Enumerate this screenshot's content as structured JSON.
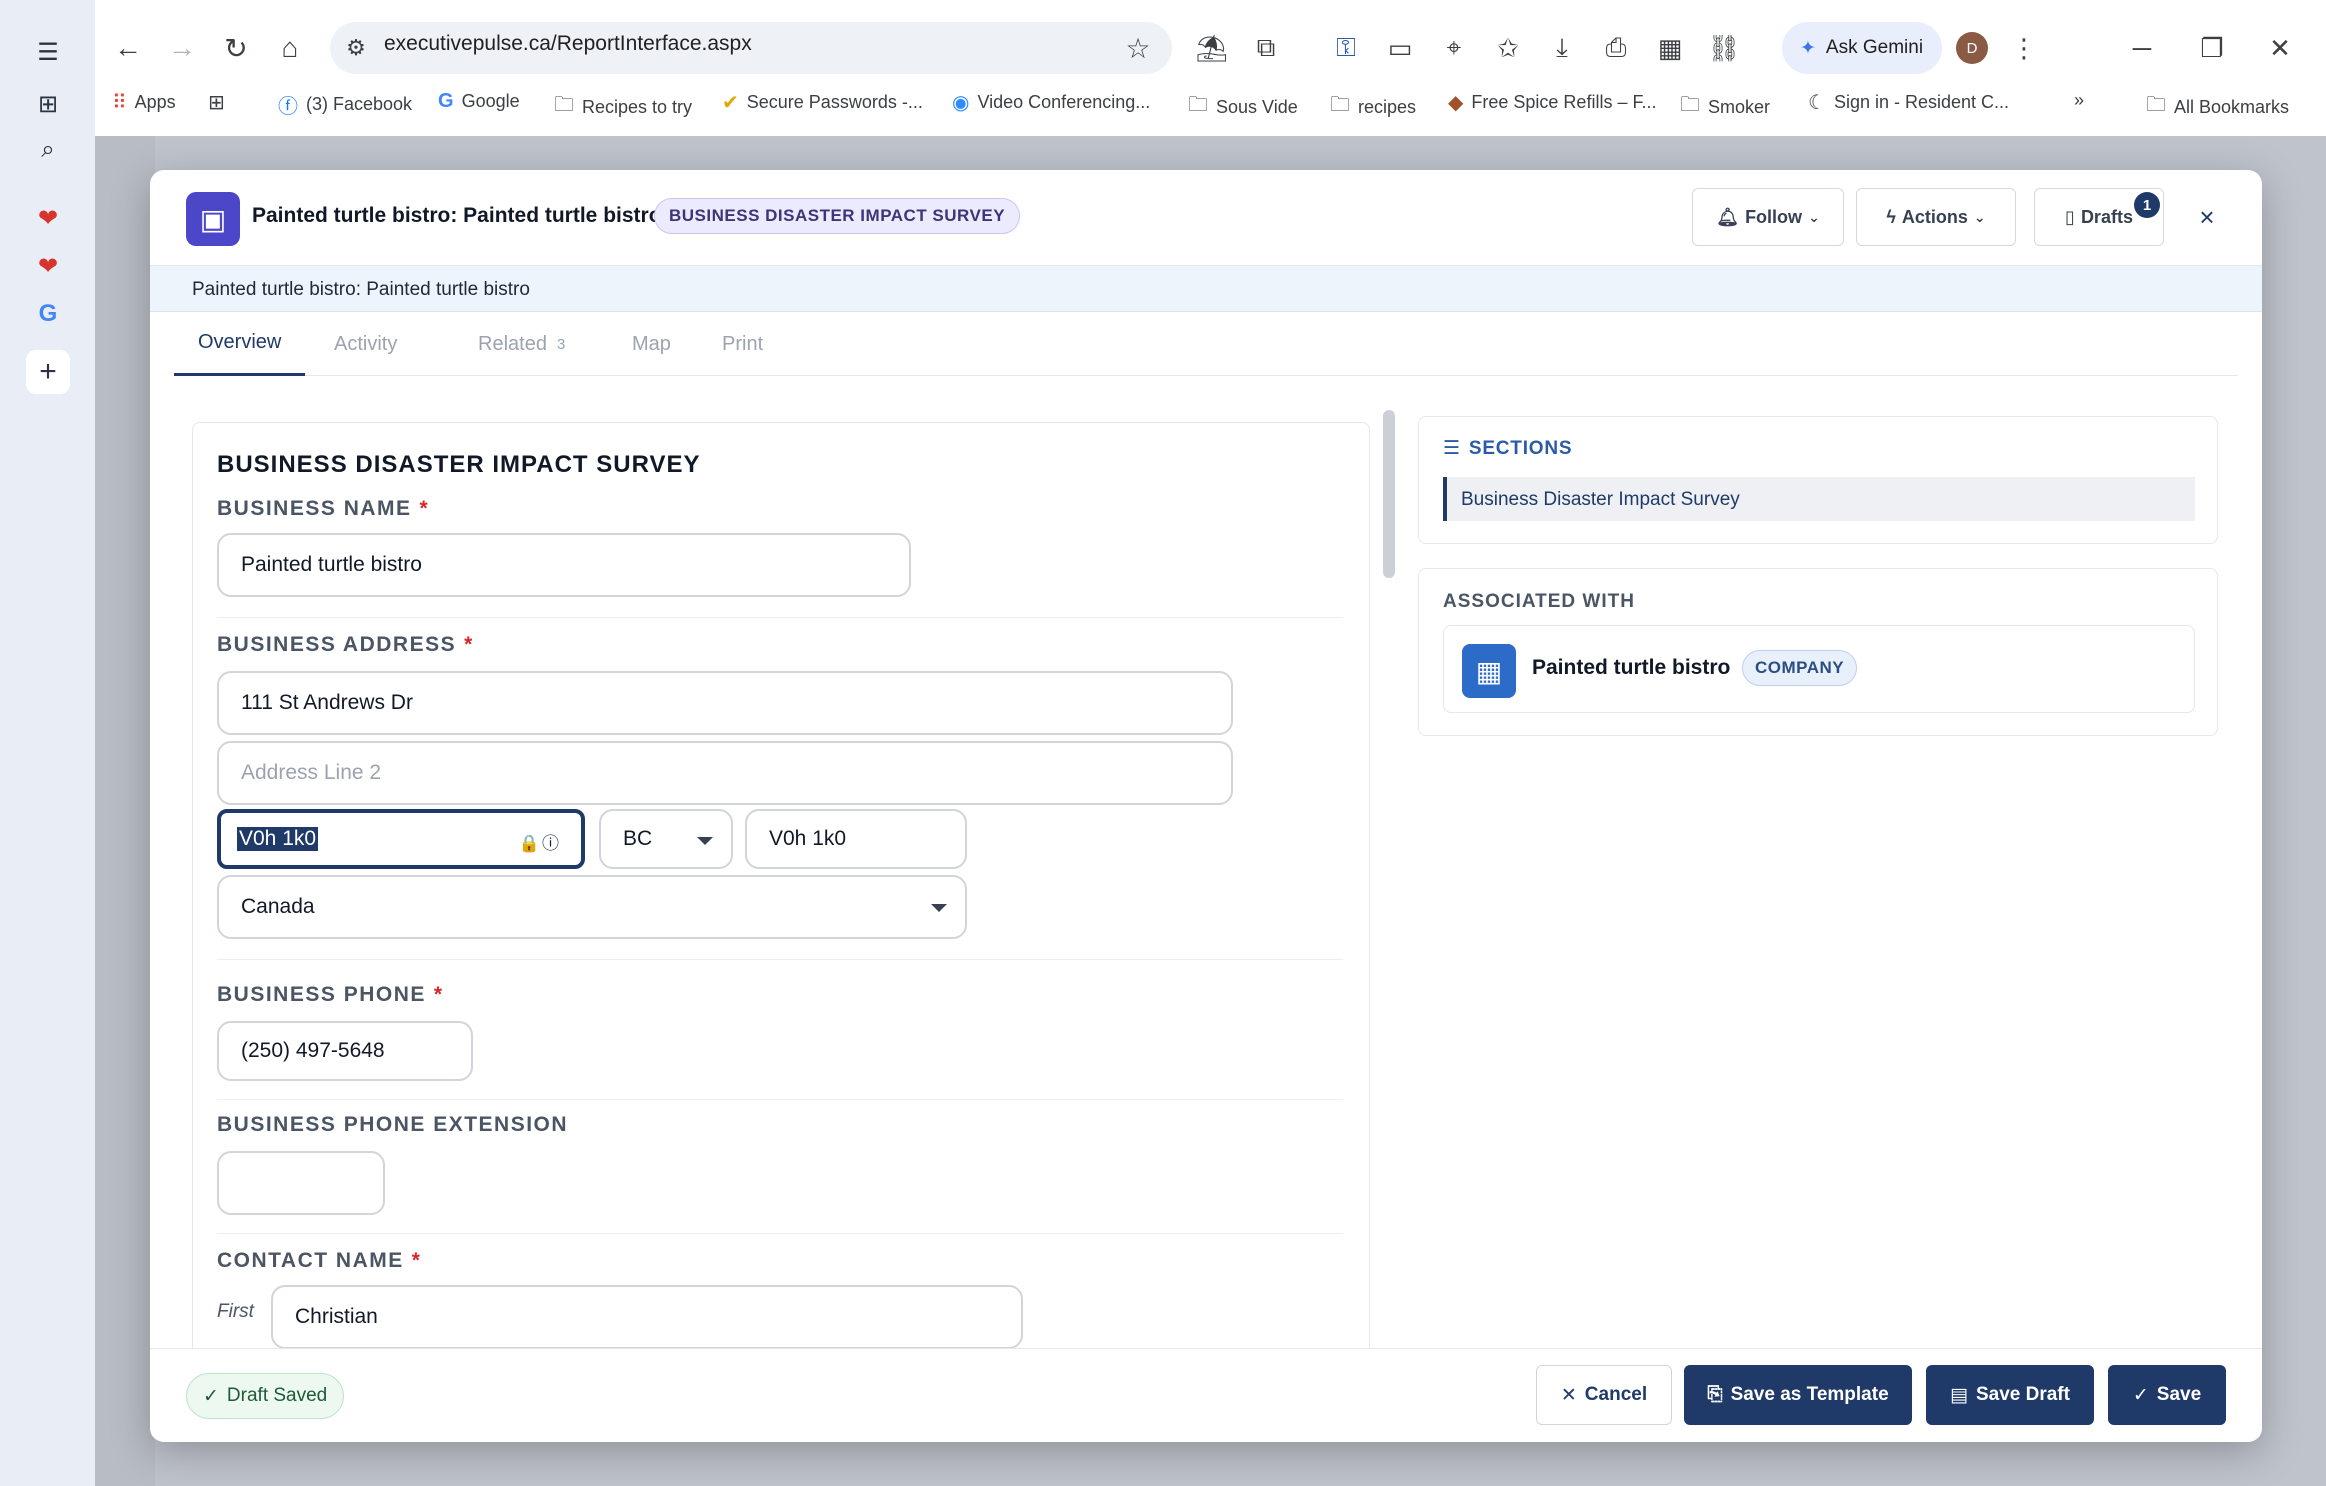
{
  "browser": {
    "url": "executivepulse.ca/ReportInterface.aspx",
    "ask_gemini": "Ask Gemini",
    "profile_initial": "D",
    "bookmarks": [
      {
        "label": "Apps",
        "icon": "apps-grid-icon"
      },
      {
        "label": "",
        "icon": "grid-icon"
      },
      {
        "label": "(3) Facebook",
        "icon": "facebook-icon"
      },
      {
        "label": "Google",
        "icon": "google-icon"
      },
      {
        "label": "Recipes to try",
        "icon": "folder-icon"
      },
      {
        "label": "Secure Passwords -...",
        "icon": "check-icon"
      },
      {
        "label": "Video Conferencing...",
        "icon": "zoom-icon"
      },
      {
        "label": "Sous Vide",
        "icon": "folder-icon"
      },
      {
        "label": "recipes",
        "icon": "folder-icon"
      },
      {
        "label": "Free Spice Refills – F...",
        "icon": "spice-icon"
      },
      {
        "label": "Smoker",
        "icon": "folder-icon"
      },
      {
        "label": "Sign in - Resident C...",
        "icon": "moon-icon"
      }
    ],
    "more_bookmarks": "»",
    "all_bookmarks": "All Bookmarks"
  },
  "modal": {
    "title": "Painted turtle bistro: Painted turtle bistro",
    "badge": "BUSINESS DISASTER IMPACT SURVEY",
    "follow_label": "Follow",
    "actions_label": "Actions",
    "drafts_label": "Drafts",
    "drafts_count": "1",
    "subtitle": "Painted turtle bistro: Painted turtle bistro",
    "tabs": [
      {
        "label": "Overview",
        "active": true
      },
      {
        "label": "Activity"
      },
      {
        "label": "Related",
        "count": "3"
      },
      {
        "label": "Map"
      },
      {
        "label": "Print"
      }
    ]
  },
  "form": {
    "title": "BUSINESS DISASTER IMPACT SURVEY",
    "business_name_label": "BUSINESS NAME",
    "business_name_value": "Painted turtle bistro",
    "business_address_label": "BUSINESS ADDRESS",
    "address_line1": "111 St Andrews Dr",
    "address_line2_placeholder": "Address Line 2",
    "postal_selected": "V0h 1k0",
    "province": "BC",
    "postal_code": "V0h 1k0",
    "country": "Canada",
    "business_phone_label": "BUSINESS PHONE",
    "business_phone_value": "(250) 497-5648",
    "phone_extension_label": "BUSINESS PHONE EXTENSION",
    "phone_extension_value": "",
    "contact_name_label": "CONTACT NAME",
    "contact_first_label": "First",
    "contact_first_value": "Christian",
    "required_mark": "*"
  },
  "sidebar": {
    "sections_label": "SECTIONS",
    "section_item": "Business Disaster Impact Survey",
    "associated_label": "ASSOCIATED WITH",
    "associated_name": "Painted turtle bistro",
    "associated_badge": "COMPANY"
  },
  "footer": {
    "draft_saved": "Draft Saved",
    "cancel": "Cancel",
    "save_template": "Save as Template",
    "save_draft": "Save Draft",
    "save": "Save"
  },
  "colors": {
    "primary": "#1f3a68",
    "accent": "#4c46c8",
    "required": "#dc2626"
  }
}
